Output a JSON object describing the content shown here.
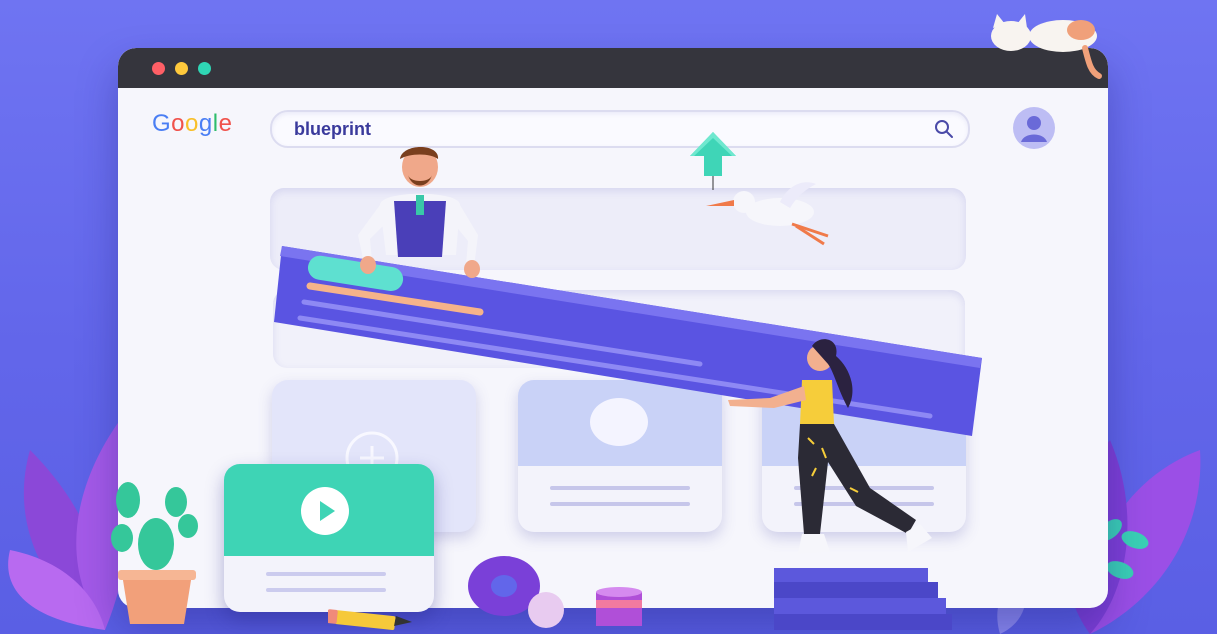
{
  "browser": {
    "window_controls": [
      "close",
      "minimize",
      "maximize"
    ],
    "logo_text": "Google",
    "search": {
      "query": "blueprint",
      "icon": "search-icon"
    },
    "account_icon": "user-avatar-icon"
  },
  "colors": {
    "background": "#6266ea",
    "accent_purple": "#5d58e0",
    "accent_teal": "#3fd5b7",
    "accent_orange": "#f6b38a",
    "titlebar": "#35353d"
  },
  "illustration": {
    "elements": [
      "man-figure",
      "woman-figure",
      "stork-bird",
      "upload-arrow",
      "cat",
      "cactus",
      "video-card",
      "pencil",
      "stairs",
      "plants",
      "donut-shape",
      "ball",
      "cylinder"
    ]
  }
}
